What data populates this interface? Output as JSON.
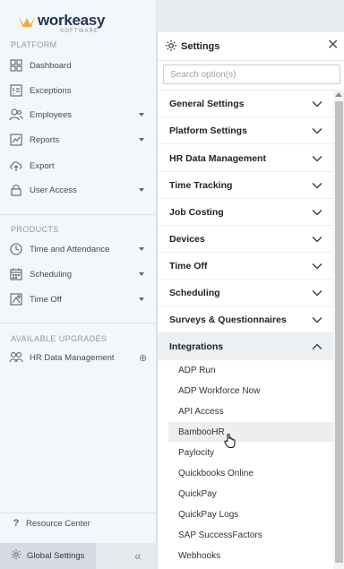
{
  "brand": {
    "name": "workeasy",
    "tagline": "SOFTWARE",
    "accent": "#f2a93b"
  },
  "sidebar": {
    "platform_heading": "PLATFORM",
    "platform_items": [
      {
        "label": "Dashboard",
        "icon": "dashboard-icon"
      },
      {
        "label": "Exceptions",
        "icon": "exceptions-icon"
      },
      {
        "label": "Employees",
        "icon": "employees-icon"
      },
      {
        "label": "Reports",
        "icon": "reports-icon"
      },
      {
        "label": "Export",
        "icon": "export-icon"
      },
      {
        "label": "User Access",
        "icon": "lock-icon"
      }
    ],
    "products_heading": "PRODUCTS",
    "product_items": [
      {
        "label": "Time and Attendance",
        "icon": "clock-icon"
      },
      {
        "label": "Scheduling",
        "icon": "calendar-icon"
      },
      {
        "label": "Time Off",
        "icon": "time-off-icon"
      }
    ],
    "upgrades_heading": "AVAILABLE UPGRADES",
    "upgrade_items": [
      {
        "label": "HR Data Management",
        "icon": "people-icon"
      }
    ],
    "resource_center": "Resource Center",
    "global_settings": "Global Settings"
  },
  "settings": {
    "title": "Settings",
    "search_placeholder": "Search option(s)",
    "sections": [
      "General Settings",
      "Platform Settings",
      "HR Data Management",
      "Time Tracking",
      "Job Costing",
      "Devices",
      "Time Off",
      "Scheduling",
      "Surveys & Questionnaires",
      "Integrations"
    ],
    "expanded_section": "Integrations",
    "integrations": [
      "ADP Run",
      "ADP Workforce Now",
      "API Access",
      "BambooHR",
      "Paylocity",
      "Quickbooks Online",
      "QuickPay",
      "QuickPay Logs",
      "SAP SuccessFactors",
      "Webhooks"
    ],
    "hovered_item": "BambooHR"
  }
}
